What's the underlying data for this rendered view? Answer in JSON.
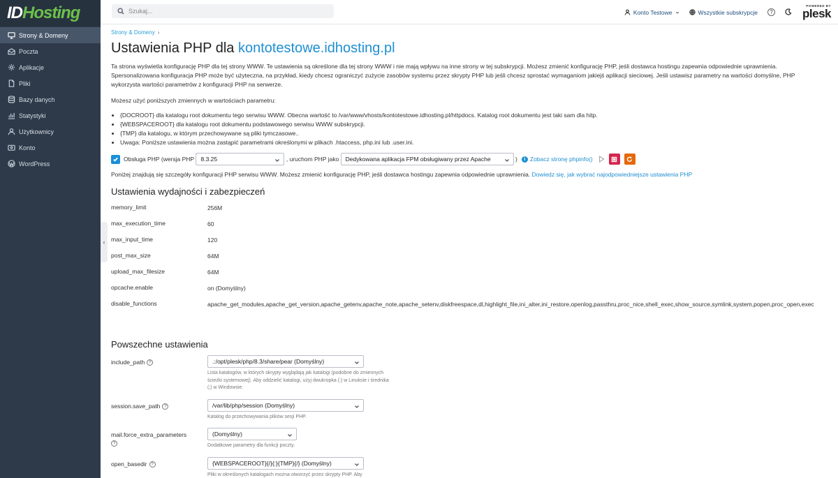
{
  "brand": {
    "logo_part1": "ID",
    "logo_part2": "Hosting"
  },
  "sidebar": {
    "items": [
      {
        "label": "Strony & Domeny",
        "icon": "monitor-icon",
        "active": true
      },
      {
        "label": "Poczta",
        "icon": "mail-icon",
        "active": false
      },
      {
        "label": "Aplikacje",
        "icon": "gear-icon",
        "active": false
      },
      {
        "label": "Pliki",
        "icon": "folder-icon",
        "active": false
      },
      {
        "label": "Bazy danych",
        "icon": "database-icon",
        "active": false
      },
      {
        "label": "Statystyki",
        "icon": "chart-icon",
        "active": false
      },
      {
        "label": "Użytkownicy",
        "icon": "user-icon",
        "active": false
      },
      {
        "label": "Konto",
        "icon": "account-icon",
        "active": false
      },
      {
        "label": "WordPress",
        "icon": "wordpress-icon",
        "active": false
      }
    ]
  },
  "header": {
    "search_placeholder": "Szukaj...",
    "account": "Konto Testowe",
    "subscriptions": "Wszystkie subskrypcje",
    "powered_by": "POWERED BY",
    "plesk": "plesk"
  },
  "breadcrumb": {
    "item": "Strony & Domeny",
    "sep": "›"
  },
  "page": {
    "title_prefix": "Ustawienia PHP dla ",
    "title_domain": "kontotestowe.idhosting.pl",
    "description": "Ta strona wyświetla konfigurację PHP dla tej strony WWW. Te ustawienia są określone dla tej strony WWW i nie mają wpływu na inne strony w tej subskrypcji. Możesz zmienić konfigurację PHP, jeśli dostawca hostingu zapewnia odpowiednie uprawnienia. Spersonalizowana konfiguracja PHP może być użyteczna, na przykład, kiedy chcesz ograniczyć zużycie zasobów systemu przez skrypty PHP lub jeśli chcesz sprostać wymaganiom jakiejś aplikacji sieciowej. Jeśli ustawisz parametry na wartości domyślne, PHP wykorzysta wartości parametrów z konfiguracji PHP na serwerze.",
    "vars_intro": "Możesz użyć poniższych zmiennych w wartościach parametru:",
    "vars": [
      "{DOCROOT} dla katalogu root dokumentu tego serwisu WWW. Obecna wartość to /var/www/vhosts/kontotestowe.idhosting.pl/httpdocs. Katalog root dokumentu jest taki sam dla hitp.",
      "{WEBSPACEROOT} dla katalogu root dokumentu podstawowego serwisu WWW subskrypcji.",
      "{TMP} dla katalogu, w którym przechowywane są pliki tymczasowe..",
      "Uwaga: Poniższe ustawienia można zastąpić parametrami określonymi w plikach .htaccess, php.ini lub .user.ini."
    ]
  },
  "php_support": {
    "label": "Obsługa PHP",
    "version_label": "(wersja PHP",
    "version": "8.3.25",
    "run_as_label": ", uruchom PHP jako",
    "handler": "Dedykowana aplikacja FPM obsługiwany przez Apache",
    "close_paren": ")",
    "phpinfo_link": "Zobacz stronę phpinfo()",
    "checked": true,
    "colors": {
      "checkbox": "#1b8fd8",
      "btn_red": "#d6264e",
      "btn_orange": "#e5680d"
    }
  },
  "details": {
    "text": "Poniżej znajdują się szczegóły konfiguracji PHP serwisu WWW. Możesz zmienić konfigurację PHP, jeśli dostawca hostingu zapewnia odpowiednie uprawnienia.",
    "link": "Dowiedz się, jak wybrać najodpowiedniejsze ustawienia PHP"
  },
  "performance": {
    "title": "Ustawienia wydajności i zabezpieczeń",
    "rows": [
      {
        "key": "memory_limit",
        "value": "256M"
      },
      {
        "key": "max_execution_time",
        "value": "60"
      },
      {
        "key": "max_input_time",
        "value": "120"
      },
      {
        "key": "post_max_size",
        "value": "64M"
      },
      {
        "key": "upload_max_filesize",
        "value": "64M"
      },
      {
        "key": "opcache.enable",
        "value": "on (Domyślny)"
      },
      {
        "key": "disable_functions",
        "value": "apache_get_modules,apache_get_version,apache_getenv,apache_note,apache_setenv,diskfreespace,dl,highlight_file,ini_alter,ini_restore,openlog,passthru,proc_nice,shell_exec,show_source,symlink,system,popen,proc_open,exec"
      }
    ]
  },
  "common": {
    "title": "Powszechne ustawienia",
    "settings": [
      {
        "key": "include_path",
        "value": ".:/opt/plesk/php/8.3/share/pear (Domyślny)",
        "hint": "Lista katalogów, w których skrypty wyglądają jak katalogi (podobne do zmiennych ścieżki systemowej). Aby oddzielić katalogi, użyj dwukropka (:) w Linuksie i średnika (;) w Windowsie."
      },
      {
        "key": "session.save_path",
        "value": "/var/lib/php/session (Domyślny)",
        "hint": "Katalog do przechowywania plików sesji PHP."
      },
      {
        "key": "mail.force_extra_parameters",
        "value": "(Domyślny)",
        "hint": "Dodatkowe parametry dla funkcji poczty."
      },
      {
        "key": "open_basedir",
        "value": "{WEBSPACEROOT}{/}{:}{TMP}{/} (Domyślny)",
        "hint": "Pliki w określonych katalogach można otworzyć przez skrypty PHP. Aby"
      }
    ]
  }
}
